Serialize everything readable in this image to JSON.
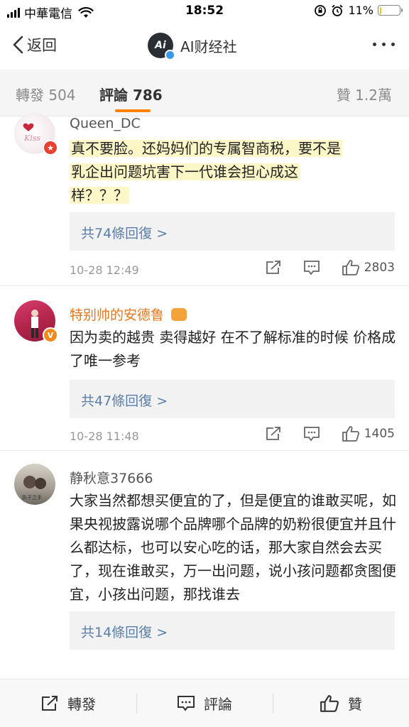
{
  "status_bar": {
    "carrier": "中華電信",
    "time": "18:52",
    "battery_percent": "11%",
    "battery_level": 0.11,
    "battery_color": "#f5c518"
  },
  "nav": {
    "back_label": "返回",
    "title": "AI财经社",
    "avatar_text": "Ai",
    "back_icon": "chevron-left-icon",
    "more_icon": "more-dots-icon"
  },
  "tabs": {
    "repost": "轉發 504",
    "comments": "評論 786",
    "likes": "贊 1.2萬",
    "accent_color": "#ff8200"
  },
  "comments": [
    {
      "user": "Queen_DC",
      "text_lines": [
        "真不要脸。还妈妈们的专属智商税，要不是",
        "乳企出问题坑害下一代谁会担心成这",
        "样？？？"
      ],
      "replies": "共74條回復 >",
      "time": "10-28 12:49",
      "likes": "2803"
    },
    {
      "user": "特别帅的安德鲁",
      "text": "因为卖的越贵 卖得越好 在不了解标准的时候 价格成了唯一参考",
      "replies": "共47條回復 >",
      "time": "10-28 11:48",
      "likes": "1405"
    },
    {
      "user": "静秋意37666",
      "text": "大家当然都想买便宜的了，但是便宜的谁敢买呢，如果央视披露说哪个品牌哪个品牌的奶粉很便宜并且什么都达标，也可以安心吃的话，那大家自然会去买了，现在谁敢买，万一出问题，说小孩问题都贪图便宜，小孩出问题，那找谁去",
      "replies": "共14條回復 >"
    }
  ],
  "bottom_bar": {
    "repost": "轉發",
    "comment": "評論",
    "like": "贊"
  }
}
